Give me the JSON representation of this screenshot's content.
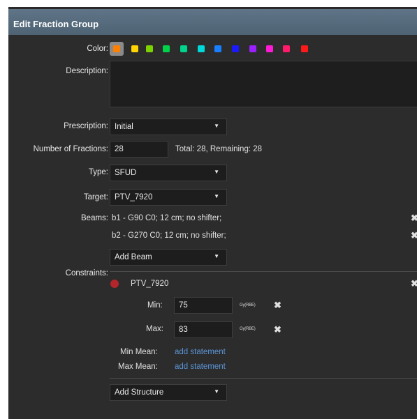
{
  "dialog": {
    "title": "Edit Fraction Group"
  },
  "labels": {
    "color": "Color:",
    "description": "Description:",
    "prescription": "Prescription:",
    "num_fractions": "Number of Fractions:",
    "type": "Type:",
    "target": "Target:",
    "beams": "Beams:",
    "constraints": "Constraints:"
  },
  "colors": [
    "#777777",
    "#ffd400",
    "#7cd300",
    "#00d34a",
    "#00d38a",
    "#00d9d9",
    "#1a7fff",
    "#1a1aff",
    "#9b20ff",
    "#ff1ad6",
    "#ff1a6a",
    "#ff1a1a"
  ],
  "fields": {
    "prescription": "Initial",
    "num_fractions": "28",
    "fractions_summary": "Total: 28, Remaining: 28",
    "type": "SFUD",
    "target": "PTV_7920",
    "add_beam": "Add Beam",
    "add_structure": "Add Structure"
  },
  "beams": [
    {
      "label": "b1 - G90 C0; 12 cm; no shifter;"
    },
    {
      "label": "b2 - G270 C0; 12 cm; no shifter;"
    }
  ],
  "constraint": {
    "structure": "PTV_7920",
    "structure_color": "#b3262b",
    "min_label": "Min:",
    "min_value": "75",
    "max_label": "Max:",
    "max_value": "83",
    "unit": "Gy(RBE)",
    "min_mean_label": "Min Mean:",
    "max_mean_label": "Max Mean:",
    "add_statement": "add statement"
  },
  "icons": {
    "remove": "✖",
    "dropdown": "▼"
  }
}
